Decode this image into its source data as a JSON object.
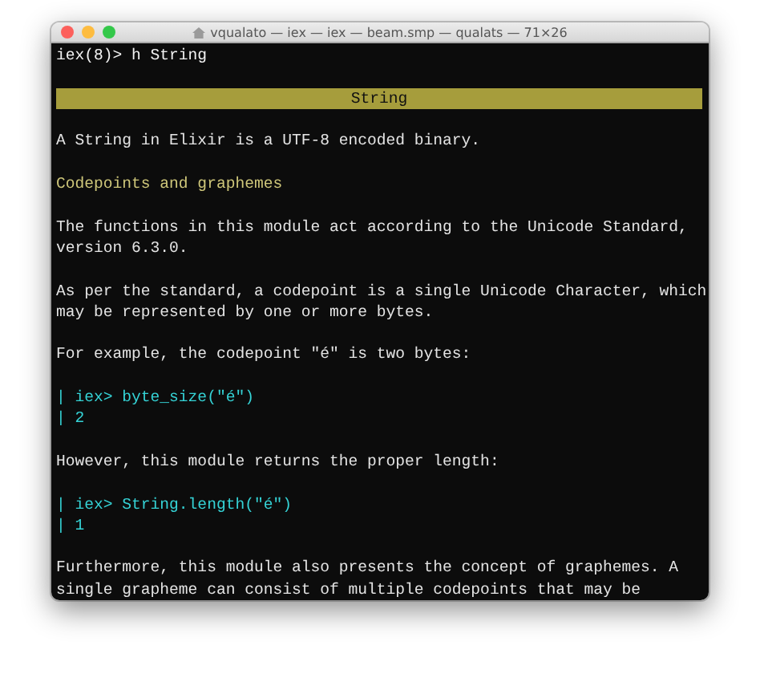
{
  "window": {
    "title": "vqualato — iex — iex — beam.smp — qualats — 71×26"
  },
  "lines": [
    {
      "kind": "prompt",
      "text": "iex(8)> h String"
    },
    {
      "kind": "blank"
    },
    {
      "kind": "banner",
      "text": "String"
    },
    {
      "kind": "blank"
    },
    {
      "kind": "text",
      "text": "A String in Elixir is a UTF-8 encoded binary."
    },
    {
      "kind": "blank"
    },
    {
      "kind": "heading",
      "text": "Codepoints and graphemes"
    },
    {
      "kind": "blank"
    },
    {
      "kind": "text",
      "text": "The functions in this module act according to the Unicode Standard,"
    },
    {
      "kind": "text",
      "text": "version 6.3.0."
    },
    {
      "kind": "blank"
    },
    {
      "kind": "text",
      "text": "As per the standard, a codepoint is a single Unicode Character, which"
    },
    {
      "kind": "text",
      "text": "may be represented by one or more bytes."
    },
    {
      "kind": "blank"
    },
    {
      "kind": "text",
      "text": "For example, the codepoint \"é\" is two bytes:"
    },
    {
      "kind": "blank"
    },
    {
      "kind": "code",
      "text": "| iex> byte_size(\"é\")"
    },
    {
      "kind": "code",
      "text": "| 2"
    },
    {
      "kind": "blank"
    },
    {
      "kind": "text",
      "text": "However, this module returns the proper length:"
    },
    {
      "kind": "blank"
    },
    {
      "kind": "code",
      "text": "| iex> String.length(\"é\")"
    },
    {
      "kind": "code",
      "text": "| 1"
    },
    {
      "kind": "blank"
    },
    {
      "kind": "text",
      "text": "Furthermore, this module also presents the concept of graphemes. A"
    },
    {
      "kind": "text",
      "text": "single grapheme can consist of multiple codepoints that may be"
    }
  ]
}
